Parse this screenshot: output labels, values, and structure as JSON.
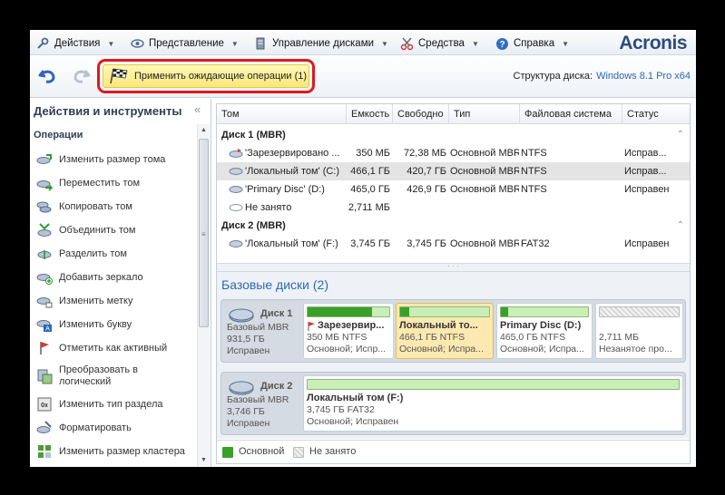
{
  "menu": {
    "items": [
      {
        "label": "Действия",
        "icon": "tools-icon"
      },
      {
        "label": "Представление",
        "icon": "eye-icon"
      },
      {
        "label": "Управление дисками",
        "icon": "disk-manage-icon"
      },
      {
        "label": "Средства",
        "icon": "scissors-icon"
      },
      {
        "label": "Справка",
        "icon": "help-icon"
      }
    ],
    "brand": "Acronis"
  },
  "toolbar": {
    "undo_icon": "undo-icon",
    "redo_icon": "redo-icon",
    "apply_label": "Применить ожидающие операции (1)",
    "apply_icon": "checkered-flag-icon",
    "structure_label": "Структура диска:",
    "structure_value": "Windows 8.1 Pro x64"
  },
  "sidebar": {
    "title": "Действия и инструменты",
    "collapse": "«",
    "section": "Операции",
    "items": [
      {
        "label": "Изменить размер тома",
        "icon": "resize-volume-icon"
      },
      {
        "label": "Переместить том",
        "icon": "move-volume-icon"
      },
      {
        "label": "Копировать том",
        "icon": "copy-volume-icon"
      },
      {
        "label": "Объединить том",
        "icon": "merge-volume-icon"
      },
      {
        "label": "Разделить том",
        "icon": "split-volume-icon"
      },
      {
        "label": "Добавить зеркало",
        "icon": "add-mirror-icon"
      },
      {
        "label": "Изменить метку",
        "icon": "label-icon"
      },
      {
        "label": "Изменить букву",
        "icon": "letter-icon"
      },
      {
        "label": "Отметить как активный",
        "icon": "active-flag-icon"
      },
      {
        "label": "Преобразовать в логический",
        "line1": "Преобразовать в",
        "line2": "логический",
        "icon": "convert-icon"
      },
      {
        "label": "Изменить тип раздела",
        "icon": "partition-type-icon"
      },
      {
        "label": "Форматировать",
        "icon": "format-icon"
      },
      {
        "label": "Изменить размер кластера",
        "icon": "cluster-size-icon"
      }
    ]
  },
  "table": {
    "columns": [
      "Том",
      "Емкость",
      "Свободно",
      "Тип",
      "Файловая система",
      "Статус"
    ],
    "groups": [
      {
        "name": "Диск 1 (MBR)",
        "rows": [
          {
            "name": "'Зарезервировано ...",
            "capacity": "350 МБ",
            "free": "72,38 МБ",
            "type": "Основной MBR",
            "fs": "NTFS",
            "status": "Исправ...",
            "icon": "system-volume-icon"
          },
          {
            "name": "'Локальный том' (C:)",
            "capacity": "466,1 ГБ",
            "free": "420,7 ГБ",
            "type": "Основной MBR",
            "fs": "NTFS",
            "status": "Исправ...",
            "icon": "volume-icon",
            "selected": true
          },
          {
            "name": "'Primary Disc' (D:)",
            "capacity": "465,0 ГБ",
            "free": "426,9 ГБ",
            "type": "Основной MBR",
            "fs": "NTFS",
            "status": "Исправен",
            "icon": "volume-icon"
          },
          {
            "name": "Не занято",
            "capacity": "2,711 МБ",
            "free": "",
            "type": "",
            "fs": "",
            "status": "",
            "icon": "unallocated-icon"
          }
        ]
      },
      {
        "name": "Диск 2 (MBR)",
        "rows": [
          {
            "name": "'Локальный том' (F:)",
            "capacity": "3,745 ГБ",
            "free": "3,745 ГБ",
            "type": "Основной MBR",
            "fs": "FAT32",
            "status": "Исправен",
            "icon": "volume-icon"
          }
        ]
      }
    ]
  },
  "basic_disks": {
    "title": "Базовые диски (2)",
    "disks": [
      {
        "name": "Диск 1",
        "type": "Базовый MBR",
        "size": "931,5 ГБ",
        "status": "Исправен",
        "partitions": [
          {
            "name": "Зарезервир...",
            "line1": "350 МБ NTFS",
            "line2": "Основной; Испр...",
            "used": 0.79,
            "flag": true
          },
          {
            "name": "Локальный то...",
            "line1": "466,1 ГБ NTFS",
            "line2": "Основной; Испра...",
            "used": 0.1,
            "selected": true
          },
          {
            "name": "Primary Disc (D:)",
            "line1": "465,0 ГБ NTFS",
            "line2": "Основной; Испра...",
            "used": 0.08
          },
          {
            "name": "",
            "line1": "2,711 МБ",
            "line2": "Незанятое про...",
            "unallocated": true
          }
        ]
      },
      {
        "name": "Диск 2",
        "type": "Базовый MBR",
        "size": "3,746 ГБ",
        "status": "Исправен",
        "partitions": [
          {
            "name": "Локальный том (F:)",
            "line1": "3,745 ГБ FAT32",
            "line2": "Основной; Исправен",
            "used": 0.0
          }
        ]
      }
    ]
  },
  "legend": {
    "primary": "Основной",
    "unallocated": "Не занято",
    "primary_color": "#3aa02b"
  }
}
